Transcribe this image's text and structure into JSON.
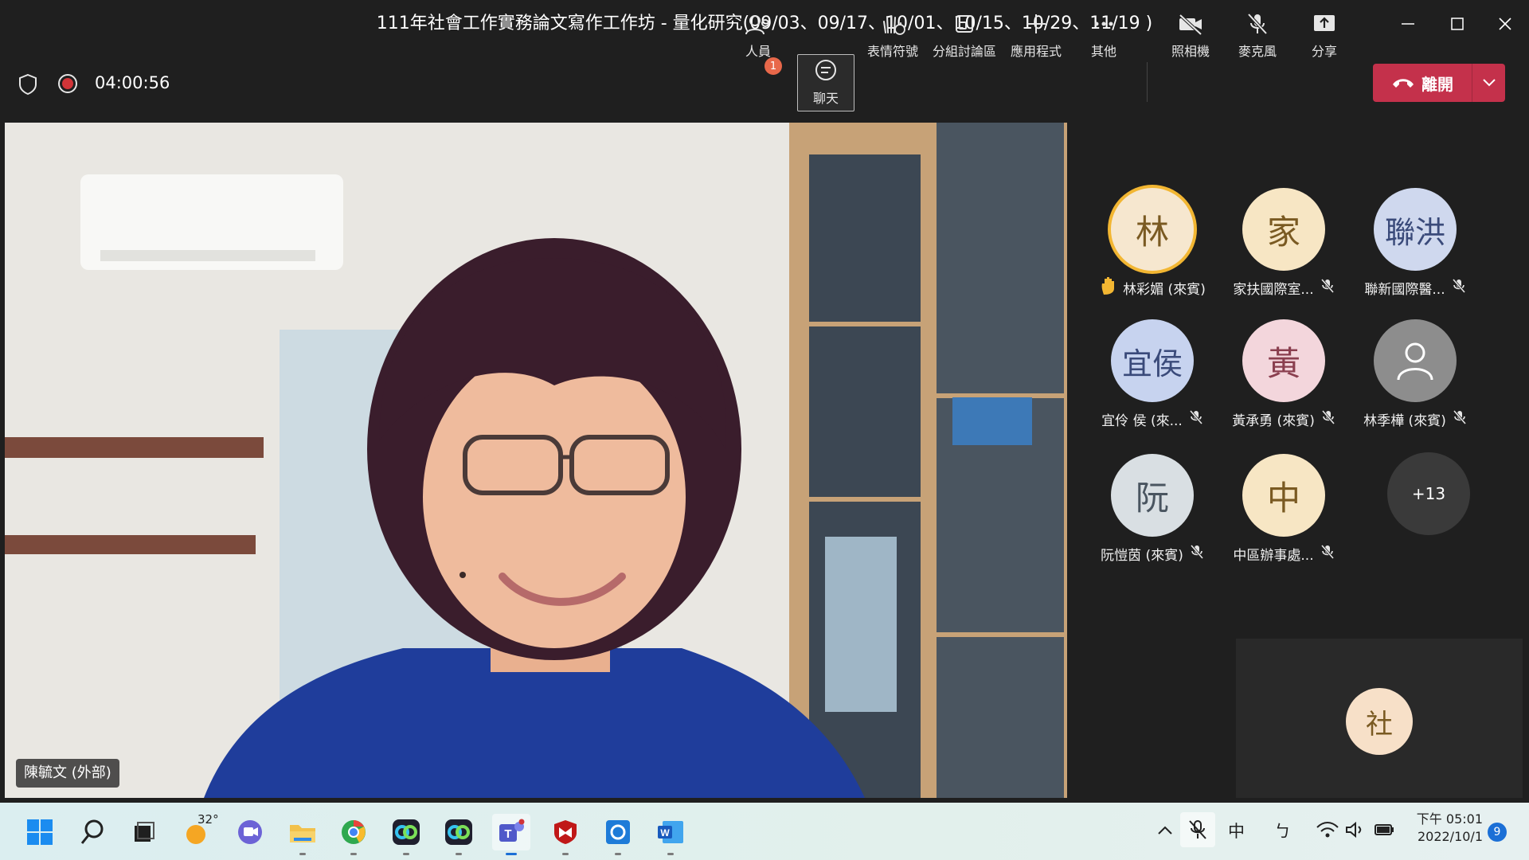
{
  "window": {
    "title": "111年社會工作實務論文寫作工作坊 - 量化研究(09/03、09/17、10/01、10/15、10/29、11/19 )"
  },
  "meeting": {
    "timer": "04:00:56"
  },
  "toolbar": {
    "people_label": "人員",
    "people_badge": "1",
    "chat_label": "聊天",
    "reactions_label": "表情符號",
    "breakout_label": "分組討論區",
    "apps_label": "應用程式",
    "more_label": "其他",
    "camera_label": "照相機",
    "mic_label": "麥克風",
    "share_label": "分享",
    "leave_label": "離開"
  },
  "stage": {
    "speaker_name": "陳毓文 (外部)"
  },
  "participants": [
    {
      "initials": "林",
      "name": "林彩媚 (來賓)",
      "hand_raised": true,
      "muted": false,
      "bg": "#f6e7cf",
      "fg": "#7a5a22"
    },
    {
      "initials": "家",
      "name": "家扶國際室...",
      "hand_raised": false,
      "muted": true,
      "bg": "#f7e6c4",
      "fg": "#7a5a22"
    },
    {
      "initials": "聯洪",
      "name": "聯新國際醫...",
      "hand_raised": false,
      "muted": true,
      "bg": "#cfd8ee",
      "fg": "#3a4a7a"
    },
    {
      "initials": "宜侯",
      "name": "宜伶 侯 (來...",
      "hand_raised": false,
      "muted": true,
      "bg": "#c7d3ef",
      "fg": "#3a4a7a"
    },
    {
      "initials": "黃",
      "name": "黃承勇 (來賓)",
      "hand_raised": false,
      "muted": true,
      "bg": "#f3d6dc",
      "fg": "#8a3f4f"
    },
    {
      "initials": "",
      "name": "林季樺 (來賓)",
      "hand_raised": false,
      "muted": true,
      "bg": "#8d8d8d",
      "fg": "#ffffff"
    },
    {
      "initials": "阮",
      "name": "阮愷茵 (來賓)",
      "hand_raised": false,
      "muted": true,
      "bg": "#d9dfe3",
      "fg": "#4a5560"
    },
    {
      "initials": "中",
      "name": "中區辦事處...",
      "hand_raised": false,
      "muted": true,
      "bg": "#f7e6c4",
      "fg": "#7a5a22"
    }
  ],
  "overflow": {
    "label": "+13"
  },
  "self_view": {
    "initials": "社"
  },
  "taskbar": {
    "weather_temp": "32°",
    "ime_label": "中",
    "ime2_label": "ㄅ",
    "time": "下午 05:01",
    "date": "2022/10/1",
    "notification_count": "9"
  }
}
